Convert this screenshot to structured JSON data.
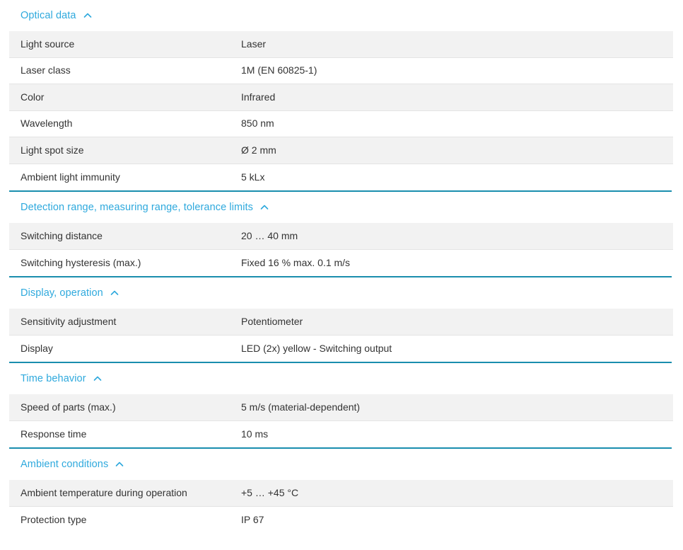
{
  "page": {
    "accent_color": "#2ea9dd",
    "divider_color": "#1a8eae",
    "row_alt_color": "#f2f2f2",
    "text_color": "#333333",
    "collapse_icon": "chevron-up"
  },
  "sections": [
    {
      "title": "Optical data",
      "has_divider_above": false,
      "rows": [
        {
          "label": "Light source",
          "value": "Laser"
        },
        {
          "label": "Laser class",
          "value": "1M (EN 60825-1)"
        },
        {
          "label": "Color",
          "value": "Infrared"
        },
        {
          "label": "Wavelength",
          "value": "850 nm"
        },
        {
          "label": "Light spot size",
          "value": "Ø 2 mm"
        },
        {
          "label": "Ambient light immunity",
          "value": "5 kLx"
        }
      ]
    },
    {
      "title": "Detection range, measuring range, tolerance limits",
      "has_divider_above": true,
      "rows": [
        {
          "label": "Switching distance",
          "value": "20 … 40 mm"
        },
        {
          "label": "Switching hysteresis (max.)",
          "value": "Fixed 16 % max. 0.1 m/s"
        }
      ]
    },
    {
      "title": "Display, operation",
      "has_divider_above": true,
      "rows": [
        {
          "label": "Sensitivity adjustment",
          "value": "Potentiometer"
        },
        {
          "label": "Display",
          "value": "LED (2x) yellow - Switching output"
        }
      ]
    },
    {
      "title": "Time behavior",
      "has_divider_above": true,
      "rows": [
        {
          "label": "Speed of parts (max.)",
          "value": "5 m/s (material-dependent)"
        },
        {
          "label": "Response time",
          "value": "10 ms"
        }
      ]
    },
    {
      "title": "Ambient conditions",
      "has_divider_above": true,
      "rows": [
        {
          "label": "Ambient temperature during operation",
          "value": "+5 … +45 °C"
        },
        {
          "label": "Protection type",
          "value": "IP 67"
        }
      ]
    }
  ]
}
